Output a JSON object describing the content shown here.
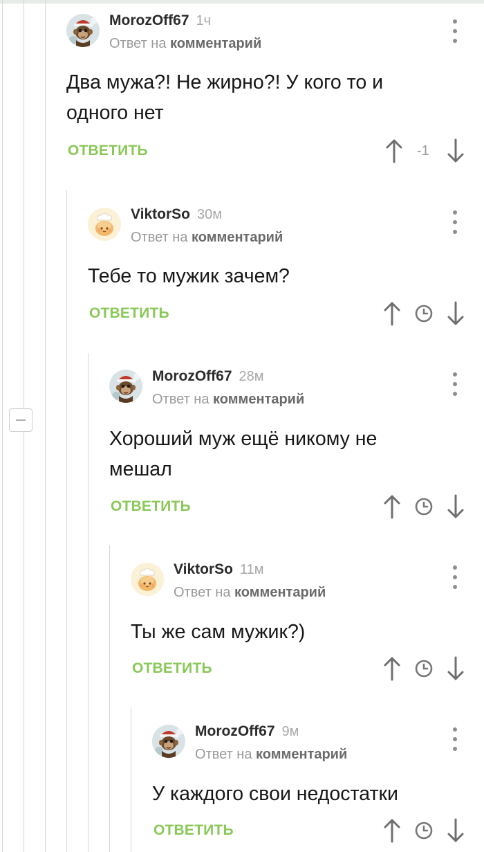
{
  "ui": {
    "reply_label": "ОТВЕТИТЬ",
    "reply_to_prefix": "Ответ на",
    "reply_to_target": "комментарий",
    "accent_color": "#8ac858"
  },
  "comments": [
    {
      "author": "MorozOff67",
      "time": "1ч",
      "lines": [
        "Два мужа?! Не жирно?! У кого то и",
        "одного нет"
      ],
      "score": "-1",
      "avatar": "monkey-avatar"
    },
    {
      "author": "ViktorSo",
      "time": "30м",
      "lines": [
        "Тебе то мужик зачем?"
      ],
      "score": "",
      "avatar": "bun-chef-avatar"
    },
    {
      "author": "MorozOff67",
      "time": "28м",
      "lines": [
        "Хороший муж ещё никому не",
        "мешал"
      ],
      "score": "",
      "avatar": "monkey-avatar"
    },
    {
      "author": "ViktorSo",
      "time": "11м",
      "lines": [
        "Ты же сам мужик?)"
      ],
      "score": "",
      "avatar": "bun-chef-avatar"
    },
    {
      "author": "MorozOff67",
      "time": "9м",
      "lines": [
        "У каждого свои недостатки"
      ],
      "score": "",
      "avatar": "monkey-avatar"
    }
  ]
}
